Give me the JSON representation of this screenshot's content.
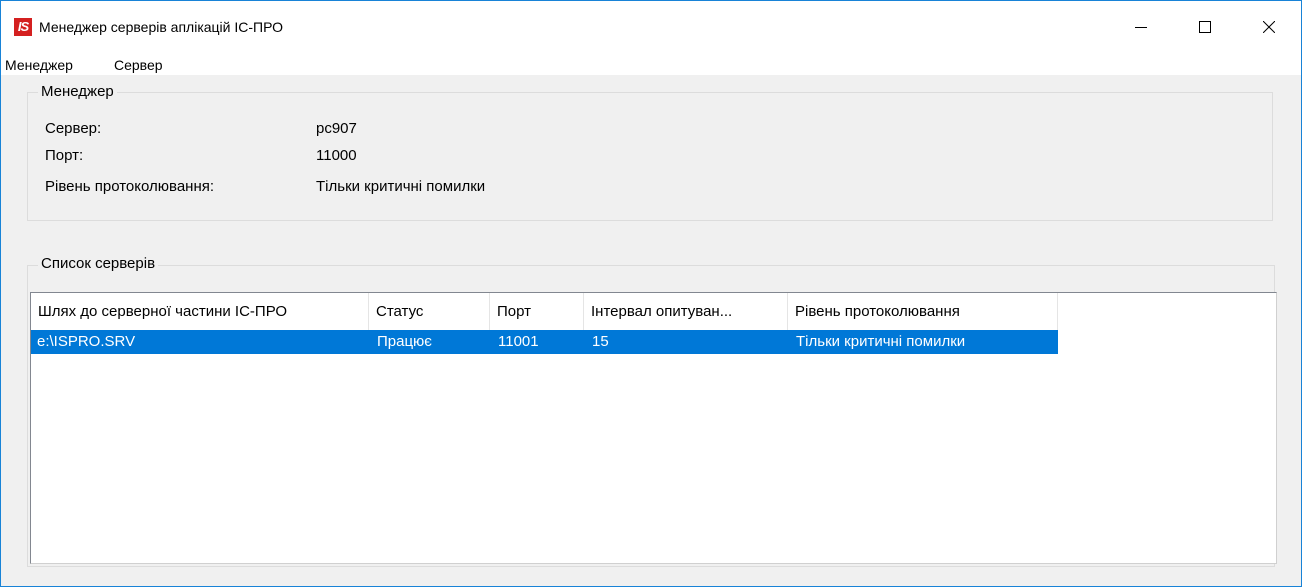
{
  "window": {
    "title": "Менеджер серверів аплікацій ІС-ПРО",
    "app_icon_text": "IS"
  },
  "menu": [
    "Менеджер",
    "Сервер"
  ],
  "manager_group": {
    "legend": "Менеджер",
    "fields": [
      {
        "label": "Сервер:",
        "value": "pc907"
      },
      {
        "label": "Порт:",
        "value": "11000"
      },
      {
        "label": "Рівень протоколювання:",
        "value": "Тільки критичні помилки"
      }
    ]
  },
  "servers_group": {
    "legend": "Список серверів",
    "columns": [
      "Шлях до серверної частини ІС-ПРО",
      "Статус",
      "Порт",
      "Інтервал опитуван...",
      "Рівень протоколювання"
    ],
    "rows": [
      [
        "e:\\ISPRO.SRV",
        "Працює",
        "11001",
        "15",
        "Тільки критичні помилки"
      ]
    ],
    "selected_row": 0
  },
  "colors": {
    "selection": "#0078d7",
    "window_border": "#1883d7",
    "app_icon": "#d42020"
  }
}
